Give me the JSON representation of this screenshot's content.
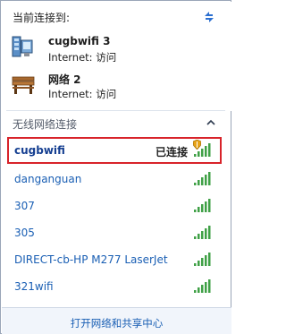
{
  "current": {
    "title": "当前连接到:",
    "networks": [
      {
        "name": "cugbwifi   3",
        "status": "Internet: 访问",
        "icon": "network-building-icon"
      },
      {
        "name": "网络  2",
        "status": "Internet: 访问",
        "icon": "bench-network-icon"
      }
    ]
  },
  "wireless": {
    "title": "无线网络连接",
    "items": [
      {
        "name": "cugbwifi",
        "status": "已连接",
        "secured": true,
        "selected": true
      },
      {
        "name": "danganguan"
      },
      {
        "name": "307"
      },
      {
        "name": "305"
      },
      {
        "name": "DIRECT-cb-HP M277 LaserJet"
      },
      {
        "name": "321wifi"
      }
    ]
  },
  "footer": {
    "link": "打开网络和共享中心"
  },
  "colors": {
    "accent": "#1a5fb4",
    "selected_border": "#d8232a",
    "signal": "#3fa046"
  }
}
